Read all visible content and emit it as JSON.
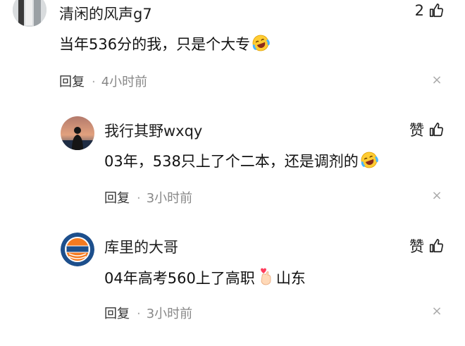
{
  "comments": [
    {
      "username": "清闲的风声g7",
      "text": "当年536分的我，只是个大专",
      "emoji": "laugh-cry",
      "reply_label": "回复",
      "time": "4小时前",
      "likes": "2",
      "close": "×"
    },
    {
      "username": "我行其野wxqy",
      "text": "03年，538只上了个二本，还是调剂的",
      "emoji": "laugh-cry",
      "reply_label": "回复",
      "time": "3小时前",
      "likes": "赞",
      "close": "×"
    },
    {
      "username": "库里的大哥",
      "text": "04年高考560上了高职",
      "emoji": "finger-heart",
      "text_after": "山东",
      "reply_label": "回复",
      "time": "3小时前",
      "likes": "赞",
      "close": "×"
    }
  ],
  "separator": "·"
}
